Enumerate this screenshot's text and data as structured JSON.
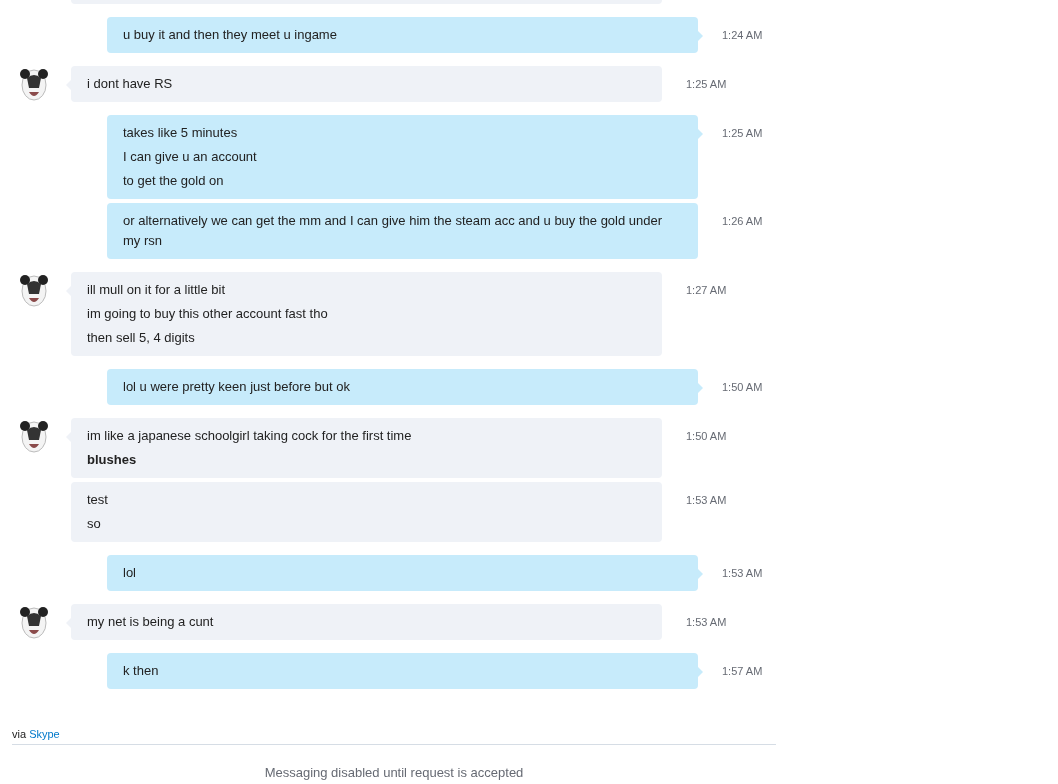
{
  "conversation": [
    {
      "kind": "incoming_cut"
    },
    {
      "kind": "outgoing",
      "bubbles": [
        {
          "lines": [
            "u buy it and then they meet u ingame"
          ],
          "time": "1:24 AM"
        }
      ]
    },
    {
      "kind": "incoming",
      "bubbles": [
        {
          "lines": [
            "i dont have RS"
          ],
          "time": "1:25 AM"
        }
      ]
    },
    {
      "kind": "outgoing",
      "bubbles": [
        {
          "lines": [
            "takes like 5 minutes",
            "I can give u an account",
            "to get the gold on"
          ],
          "time": "1:25 AM"
        },
        {
          "lines": [
            "or alternatively we can get the mm and I can give him the steam acc and u buy the gold under my rsn"
          ],
          "time": "1:26 AM"
        }
      ]
    },
    {
      "kind": "incoming",
      "bubbles": [
        {
          "lines": [
            "ill mull on it for a little bit",
            "im going to buy this other account fast tho",
            "then sell 5, 4 digits"
          ],
          "time": "1:27 AM"
        }
      ]
    },
    {
      "kind": "outgoing",
      "bubbles": [
        {
          "lines": [
            "lol u were pretty keen just before but ok"
          ],
          "time": "1:50 AM"
        }
      ]
    },
    {
      "kind": "incoming",
      "bubbles": [
        {
          "lines": [
            "im like a japanese schoolgirl taking cock for the first time",
            "**blushes**"
          ],
          "time": "1:50 AM"
        },
        {
          "lines": [
            "test",
            "so"
          ],
          "time": "1:53 AM"
        }
      ]
    },
    {
      "kind": "outgoing",
      "bubbles": [
        {
          "lines": [
            "lol"
          ],
          "time": "1:53 AM"
        }
      ]
    },
    {
      "kind": "incoming",
      "bubbles": [
        {
          "lines": [
            "my net is being a cunt"
          ],
          "time": "1:53 AM"
        }
      ]
    },
    {
      "kind": "outgoing",
      "bubbles": [
        {
          "lines": [
            "k then"
          ],
          "time": "1:57 AM"
        }
      ]
    }
  ],
  "via": {
    "prefix": "via",
    "link": "Skype"
  },
  "notice": "Messaging disabled until request is accepted"
}
